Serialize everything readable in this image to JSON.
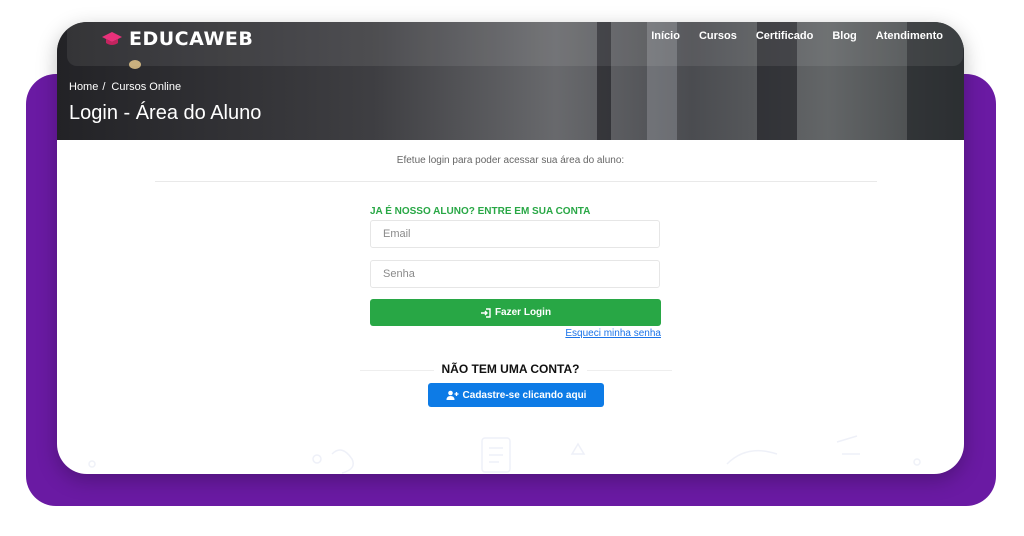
{
  "brand": {
    "name": "EDUCAWEB"
  },
  "nav": {
    "items": [
      {
        "label": "Início"
      },
      {
        "label": "Cursos"
      },
      {
        "label": "Certificado"
      },
      {
        "label": "Blog"
      },
      {
        "label": "Atendimento"
      }
    ]
  },
  "breadcrumb": {
    "items": [
      "Home",
      "Cursos Online"
    ],
    "separator": "/"
  },
  "page": {
    "title": "Login - Área do Aluno",
    "intro": "Efetue login para poder acessar sua área do aluno:"
  },
  "login": {
    "heading": "JA É NOSSO ALUNO? ENTRE EM SUA CONTA",
    "email_placeholder": "Email",
    "password_placeholder": "Senha",
    "submit_label": "Fazer Login",
    "forgot_label": "Esqueci minha senha"
  },
  "signup": {
    "heading": "NÃO TEM UMA CONTA?",
    "button_label": "Cadastre-se clicando aqui"
  },
  "colors": {
    "accent_green": "#28a745",
    "accent_blue": "#0d7be6",
    "frame_purple": "#6a1aa3",
    "logo_pink": "#e8317a"
  },
  "icons": {
    "logo": "graduation-cap-icon",
    "login": "sign-in-icon",
    "signup": "user-plus-icon"
  }
}
